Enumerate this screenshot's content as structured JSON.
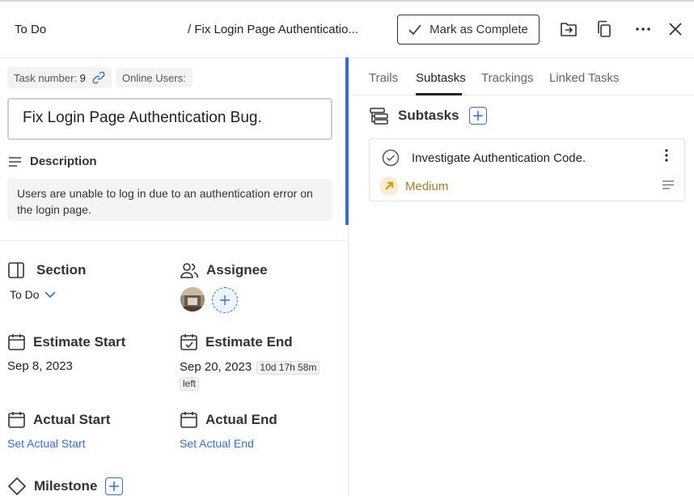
{
  "header": {
    "section": "To Do",
    "title": "/ Fix Login Page Authenticatio...",
    "complete_label": "Mark as Complete"
  },
  "task": {
    "number_label": "Task number:",
    "number": "9",
    "online_users_label": "Online Users:",
    "title": "Fix Login Page Authentication Bug.",
    "description_label": "Description",
    "description": "Users are unable to log in due to an authentication error on the login page."
  },
  "fields": {
    "section_label": "Section",
    "section_value": "To Do",
    "assignee_label": "Assignee",
    "estimate_start_label": "Estimate Start",
    "estimate_start_value": "Sep 8, 2023",
    "estimate_end_label": "Estimate End",
    "estimate_end_value": "Sep 20, 2023",
    "estimate_end_remaining": "10d 17h 58m",
    "estimate_end_left": "left",
    "actual_start_label": "Actual Start",
    "actual_start_link": "Set Actual Start",
    "actual_end_label": "Actual End",
    "actual_end_link": "Set Actual End",
    "milestone_label": "Milestone"
  },
  "tabs": [
    "Trails",
    "Subtasks",
    "Trackings",
    "Linked Tasks"
  ],
  "subtasks": {
    "heading": "Subtasks",
    "items": [
      {
        "title": "Investigate Authentication Code.",
        "priority": "Medium"
      }
    ]
  },
  "colors": {
    "accent": "#2f6fde",
    "priority_medium": "#b07a1a"
  }
}
